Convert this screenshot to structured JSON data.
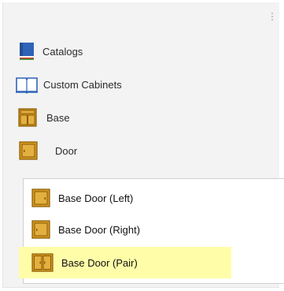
{
  "tree": {
    "items": [
      {
        "label": "Catalogs",
        "icon": "book-icon"
      },
      {
        "label": "Custom Cabinets",
        "icon": "open-book-icon"
      },
      {
        "label": "Base",
        "icon": "base-cabinet-icon"
      },
      {
        "label": "Door",
        "icon": "cabinet-door-icon"
      }
    ],
    "children": [
      {
        "label": "Base Door (Left)",
        "icon": "cabinet-door-icon"
      },
      {
        "label": "Base Door (Right)",
        "icon": "cabinet-door-icon"
      },
      {
        "label": "Base Door (Pair)",
        "icon": "double-door-icon",
        "selected": true
      }
    ]
  },
  "colors": {
    "panel_bg": "#f3f3f3",
    "wood": "#d49a1f",
    "wood_dark": "#8a5a08",
    "selection_highlight": "#fffda8"
  }
}
